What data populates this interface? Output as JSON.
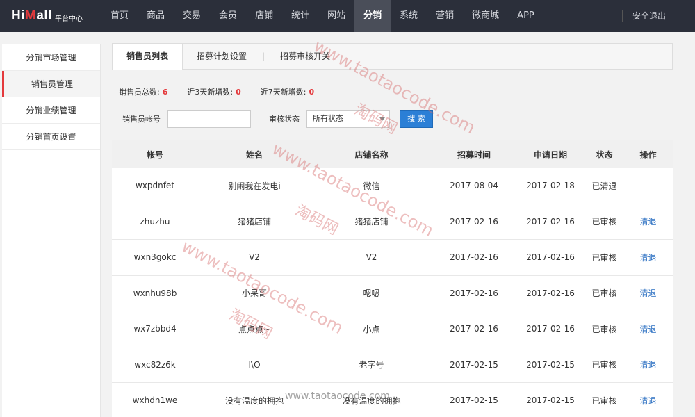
{
  "logo": {
    "main_a": "Hi",
    "main_m": "M",
    "main_b": "all",
    "sub": "平台中心"
  },
  "nav": {
    "items": [
      "首页",
      "商品",
      "交易",
      "会员",
      "店铺",
      "统计",
      "网站",
      "分销",
      "系统",
      "营销",
      "微商城",
      "APP"
    ],
    "active": "分销",
    "logout": "安全退出"
  },
  "sidebar": {
    "items": [
      "分销市场管理",
      "销售员管理",
      "分销业绩管理",
      "分销首页设置"
    ],
    "active": "销售员管理"
  },
  "tabs": [
    "销售员列表",
    "招募计划设置",
    "招募审核开关"
  ],
  "stats": [
    {
      "label": "销售员总数:",
      "value": "6"
    },
    {
      "label": "近3天新增数:",
      "value": "0"
    },
    {
      "label": "近7天新增数:",
      "value": "0"
    }
  ],
  "filters": {
    "account_label": "销售员帐号",
    "status_label": "审核状态",
    "status_selected": "所有状态",
    "search_label": "搜 索"
  },
  "table": {
    "headers": [
      "帐号",
      "姓名",
      "店铺名称",
      "招募时间",
      "申请日期",
      "状态",
      "操作"
    ],
    "rows": [
      [
        "wxpdnfet",
        "别闹我在发电i",
        "微信",
        "2017-08-04",
        "2017-02-18",
        "已清退",
        ""
      ],
      [
        "zhuzhu",
        "猪猪店铺",
        "猪猪店铺",
        "2017-02-16",
        "2017-02-16",
        "已审核",
        "清退"
      ],
      [
        "wxn3gokc",
        "V2",
        "V2",
        "2017-02-16",
        "2017-02-16",
        "已审核",
        "清退"
      ],
      [
        "wxnhu98b",
        "小呆哥",
        "嗯嗯",
        "2017-02-16",
        "2017-02-16",
        "已审核",
        "清退"
      ],
      [
        "wx7zbbd4",
        "点点点~",
        "小点",
        "2017-02-16",
        "2017-02-16",
        "已审核",
        "清退"
      ],
      [
        "wxc82z6k",
        "I\\O",
        "老字号",
        "2017-02-15",
        "2017-02-15",
        "已审核",
        "清退"
      ],
      [
        "wxhdn1we",
        "没有温度的拥抱",
        "没有温度的拥抱",
        "2017-02-15",
        "2017-02-15",
        "已审核",
        "清退"
      ]
    ]
  },
  "watermark": {
    "url": "www.taotaocode.com",
    "cn": "淘码网",
    "bottom": "www.taotaocode.com"
  },
  "colors": {
    "navbar": "#2b2f3a",
    "accent": "#e4393c",
    "link": "#2b6fc2",
    "button": "#2b7fd6"
  }
}
